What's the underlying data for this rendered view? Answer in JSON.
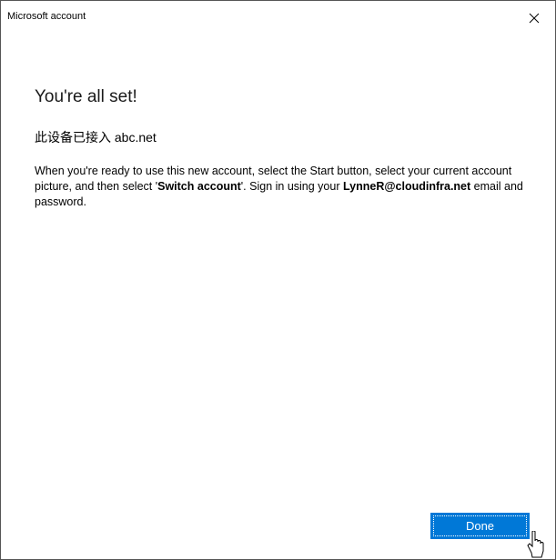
{
  "window": {
    "title": "Microsoft account",
    "close_glyph": "×"
  },
  "content": {
    "heading": "You're all set!",
    "device_line": "此设备已接入 abc.net",
    "desc_part1": "When you're ready to use this new account, select the Start button, select your current account picture, and then select '",
    "desc_switch": "Switch account",
    "desc_part2": "'. Sign in using your ",
    "desc_email": "LynneR@cloudinfra.net",
    "desc_part3": " email and password."
  },
  "buttons": {
    "done_label": "Done"
  },
  "colors": {
    "accent": "#0078d7",
    "border": "#555555"
  },
  "icons": {
    "close": "close-icon",
    "cursor": "mouse-pointer-icon"
  }
}
